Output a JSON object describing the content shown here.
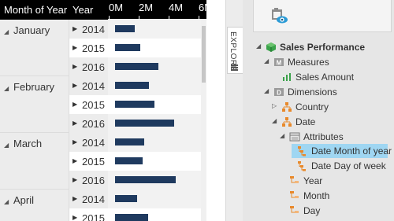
{
  "grid": {
    "header": {
      "month_col": "Month of Year",
      "year_col": "Year",
      "axis_ticks": [
        "0M",
        "2M",
        "4M",
        "6M"
      ]
    },
    "axis_max": 6,
    "months": [
      {
        "label": "January",
        "years": [
          {
            "label": "2014",
            "value": 1.5
          },
          {
            "label": "2015",
            "value": 1.9
          },
          {
            "label": "2016",
            "value": 3.3
          }
        ]
      },
      {
        "label": "February",
        "years": [
          {
            "label": "2014",
            "value": 2.6
          },
          {
            "label": "2015",
            "value": 3.0
          },
          {
            "label": "2016",
            "value": 4.5
          }
        ]
      },
      {
        "label": "March",
        "years": [
          {
            "label": "2014",
            "value": 2.2
          },
          {
            "label": "2015",
            "value": 2.1
          },
          {
            "label": "2016",
            "value": 4.6
          }
        ]
      },
      {
        "label": "April",
        "years": [
          {
            "label": "2014",
            "value": 1.7
          },
          {
            "label": "2015",
            "value": 2.5
          }
        ]
      }
    ]
  },
  "explore_tab": {
    "label": "EXPLORE"
  },
  "tree": {
    "items": [
      {
        "name": "tree-sales-performance",
        "label": "Sales Performance",
        "caret": "◢",
        "icon": "cube-icon",
        "bold": true
      },
      {
        "name": "tree-measures",
        "label": "Measures",
        "caret": "◢",
        "icon": "measures-folder-icon"
      },
      {
        "name": "tree-sales-amount",
        "label": "Sales Amount",
        "caret": "",
        "icon": "measure-icon"
      },
      {
        "name": "tree-dimensions",
        "label": "Dimensions",
        "caret": "◢",
        "icon": "dimensions-folder-icon"
      },
      {
        "name": "tree-country",
        "label": "Country",
        "caret": "▷",
        "icon": "hierarchy-icon"
      },
      {
        "name": "tree-date",
        "label": "Date",
        "caret": "◢",
        "icon": "hierarchy-icon"
      },
      {
        "name": "tree-attributes",
        "label": "Attributes",
        "caret": "◢",
        "icon": "attributes-folder-icon"
      },
      {
        "name": "tree-date-month-of-year",
        "label": "Date Month of year",
        "caret": "",
        "icon": "attribute-hierarchy-icon",
        "selected": true
      },
      {
        "name": "tree-date-day-of-week",
        "label": "Date Day of week",
        "caret": "",
        "icon": "attribute-hierarchy-icon"
      },
      {
        "name": "tree-year",
        "label": "Year",
        "caret": "",
        "icon": "level-icon"
      },
      {
        "name": "tree-month",
        "label": "Month",
        "caret": "",
        "icon": "level-icon"
      },
      {
        "name": "tree-day",
        "label": "Day",
        "caret": "",
        "icon": "level-icon"
      }
    ]
  },
  "colors": {
    "bar": "#1f3a5f",
    "header_bg": "#000000",
    "selection": "#9fd6f2",
    "hierarchy_orange": "#e8892b"
  }
}
